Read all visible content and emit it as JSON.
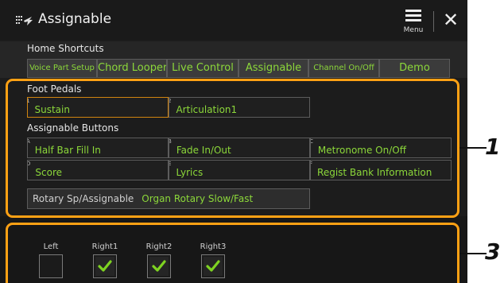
{
  "window": {
    "title": "Assignable",
    "menu_label": "Menu"
  },
  "home_shortcuts": {
    "label": "Home Shortcuts",
    "tabs": [
      "Voice Part Setup",
      "Chord Looper",
      "Live Control",
      "Assignable",
      "Channel On/Off",
      "Demo"
    ]
  },
  "foot_pedals": {
    "label": "Foot Pedals",
    "items": [
      {
        "num": "1",
        "value": "Sustain"
      },
      {
        "num": "2",
        "value": "Articulation1"
      }
    ]
  },
  "assignable_buttons": {
    "label": "Assignable Buttons",
    "items": [
      {
        "num": "A",
        "value": "Half Bar Fill In"
      },
      {
        "num": "B",
        "value": "Fade In/Out"
      },
      {
        "num": "C",
        "value": "Metronome On/Off"
      },
      {
        "num": "D",
        "value": "Score"
      },
      {
        "num": "E",
        "value": "Lyrics"
      },
      {
        "num": "F",
        "value": "Regist Bank Information"
      }
    ]
  },
  "rotary": {
    "label": "Rotary Sp/Assignable",
    "value": "Organ Rotary Slow/Fast"
  },
  "parts": [
    {
      "label": "Left",
      "checked": false
    },
    {
      "label": "Right1",
      "checked": true
    },
    {
      "label": "Right2",
      "checked": true
    },
    {
      "label": "Right3",
      "checked": true
    }
  ],
  "callouts": [
    "1",
    "3"
  ],
  "colors": {
    "accent": "#ffa114",
    "value_text": "#8cd83a",
    "check": "#7ed321"
  }
}
